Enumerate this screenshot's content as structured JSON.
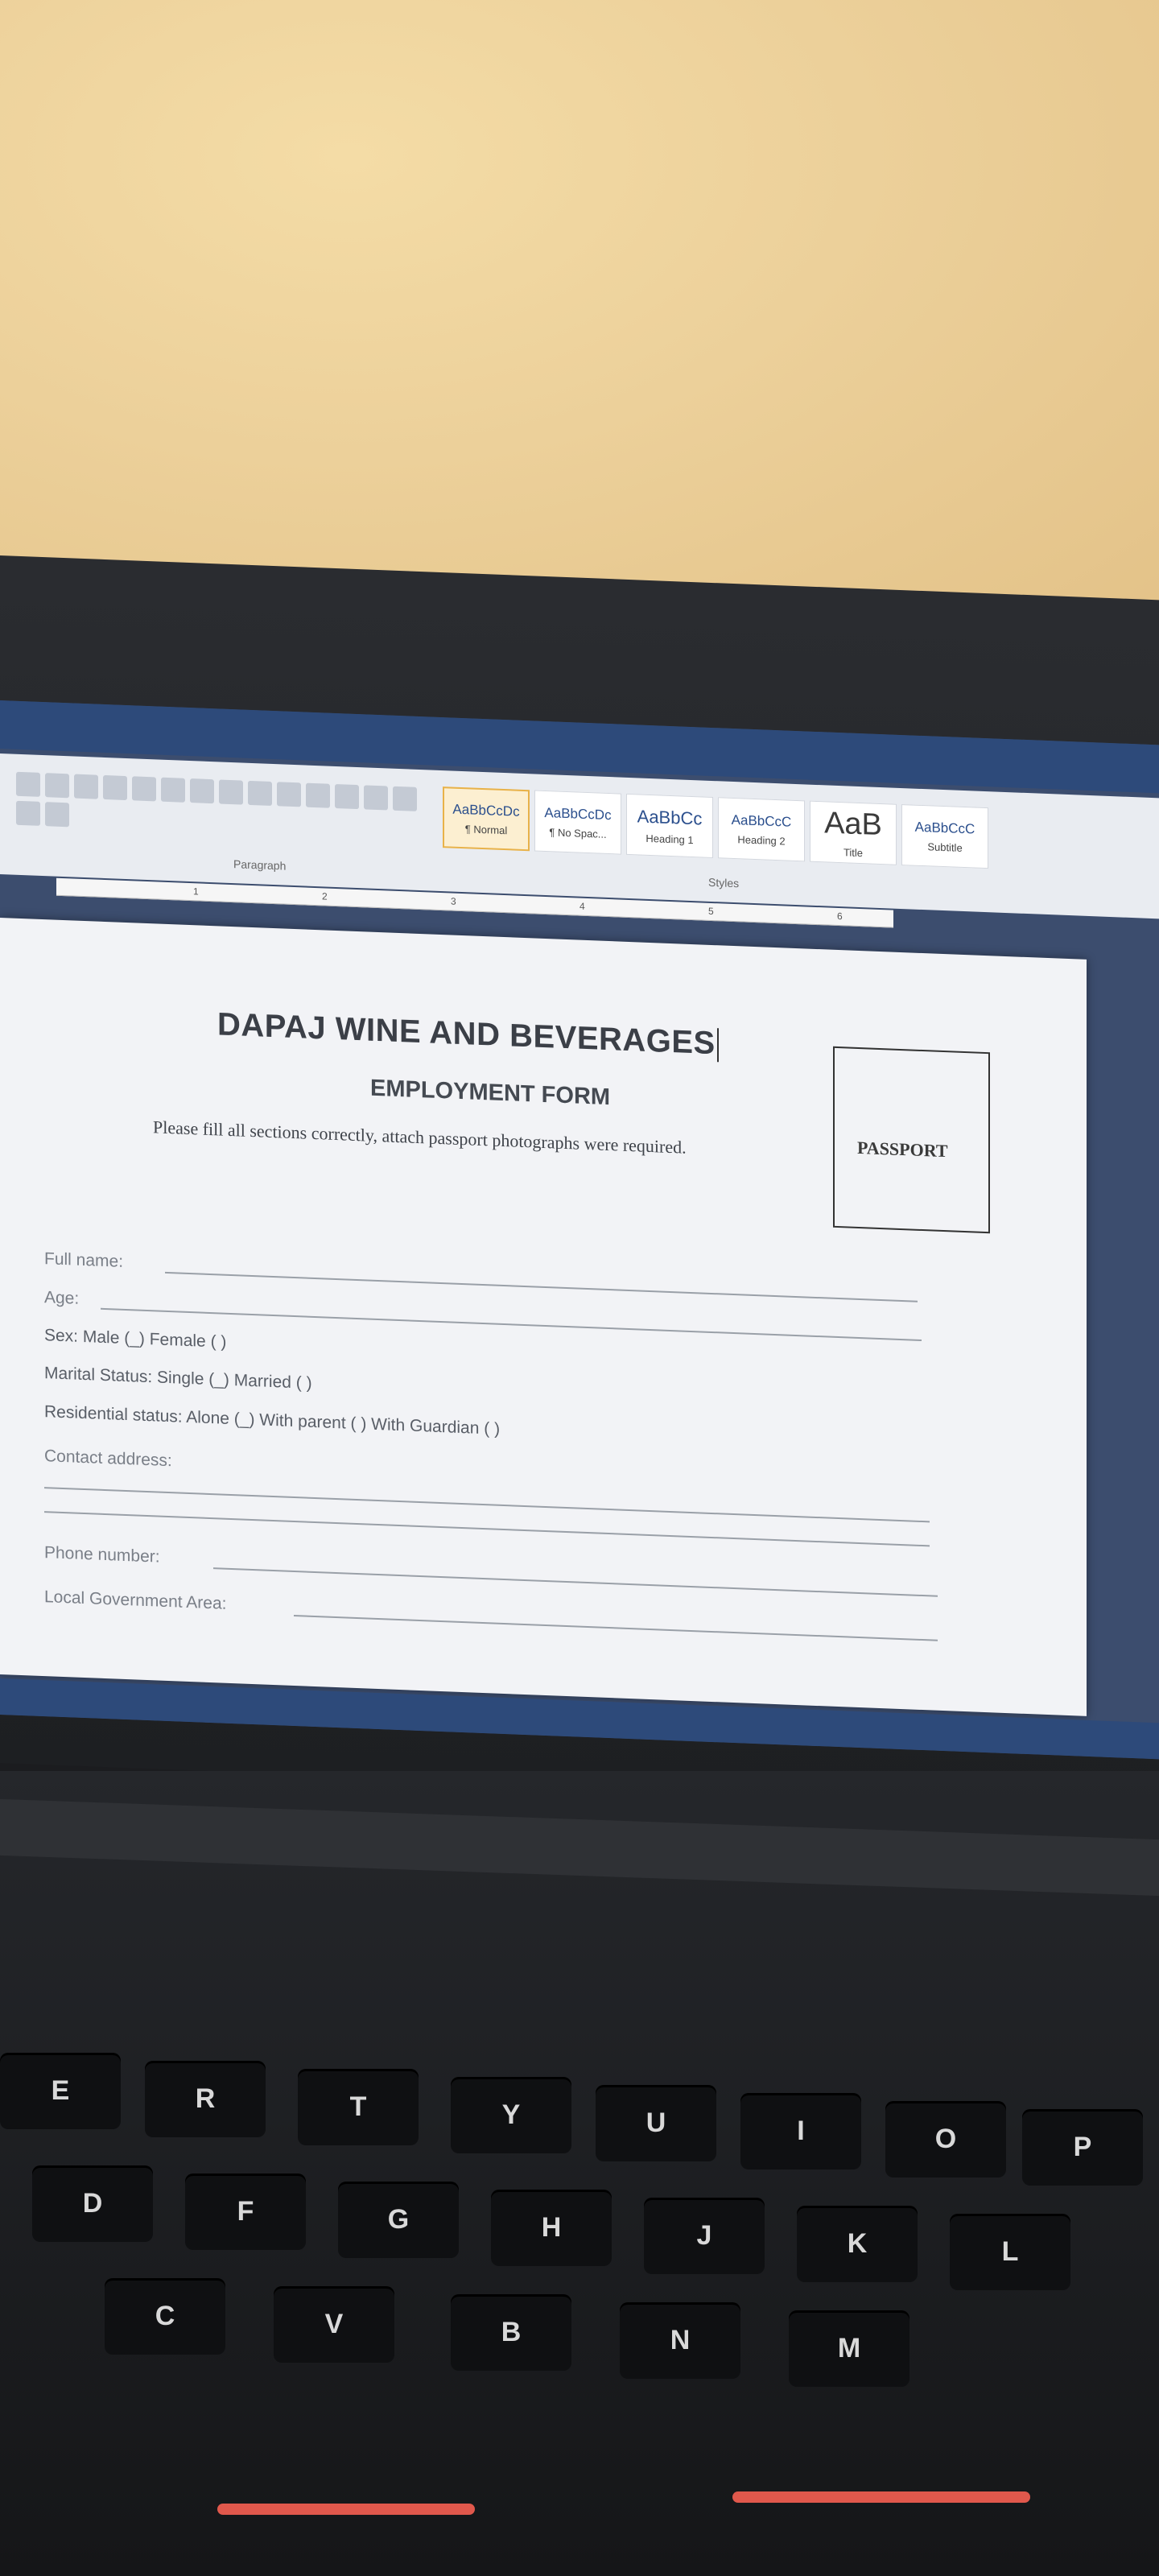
{
  "document": {
    "title": "DAPAJ WINE AND BEVERAGES",
    "subtitle": "EMPLOYMENT FORM",
    "instruction": "Please fill all sections correctly, attach passport photographs were required.",
    "passport_label": "PASSPORT",
    "fields": {
      "full_name": "Full name:",
      "age": "Age:",
      "sex": "Sex: Male (_)     Female ( )",
      "marital": "Marital Status: Single (_)       Married ( )",
      "residential": "Residential status:  Alone (_)   With parent ( ) With Guardian ( )",
      "contact": "Contact address:",
      "phone": "Phone number:",
      "lga": "Local Government Area:"
    }
  },
  "ribbon": {
    "paragraph_label": "Paragraph",
    "styles_label": "Styles",
    "styles": [
      {
        "sample": "AaBbCcDc",
        "name": "¶ Normal"
      },
      {
        "sample": "AaBbCcDc",
        "name": "¶ No Spac..."
      },
      {
        "sample": "AaBbCc",
        "name": "Heading 1"
      },
      {
        "sample": "AaBbCcC",
        "name": "Heading 2"
      },
      {
        "sample": "AaB",
        "name": "Title"
      },
      {
        "sample": "AaBbCcC",
        "name": "Subtitle"
      }
    ]
  },
  "ruler": [
    "1",
    "2",
    "3",
    "4",
    "5",
    "6"
  ],
  "keyboard": {
    "row1": [
      "E",
      "R",
      "T",
      "Y",
      "U",
      "I",
      "O",
      "P"
    ],
    "row2": [
      "D",
      "F",
      "G",
      "H",
      "J",
      "K",
      "L"
    ],
    "row3": [
      "C",
      "V",
      "B",
      "N",
      "M"
    ]
  },
  "colors": {
    "wall": "#ecd09a",
    "bezel": "#1d1f22",
    "titlebar": "#2d4a7a",
    "page": "#f2f3f6",
    "touchpad_led": "#e0584c"
  }
}
